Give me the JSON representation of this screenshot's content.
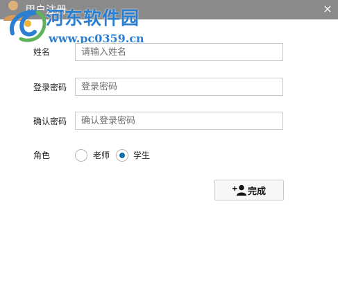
{
  "window": {
    "title": "用户注册",
    "close_glyph": "×"
  },
  "watermark": {
    "title": "河东软件园",
    "url": "www.pc0359.cn"
  },
  "form": {
    "name": {
      "label": "姓名",
      "placeholder": "请输入姓名",
      "value": ""
    },
    "password": {
      "label": "登录密码",
      "placeholder": "登录密码",
      "value": ""
    },
    "confirm": {
      "label": "确认密码",
      "placeholder": "确认登录密码",
      "value": ""
    },
    "role": {
      "label": "角色",
      "options": [
        {
          "label": "老师",
          "selected": false
        },
        {
          "label": "学生",
          "selected": true
        }
      ]
    }
  },
  "submit": {
    "label": "完成",
    "icon": "user-plus-icon"
  },
  "colors": {
    "titlebar": "#8a8a8a",
    "radio_selected": "#0f6ea8",
    "watermark": "#2b7fd0"
  }
}
